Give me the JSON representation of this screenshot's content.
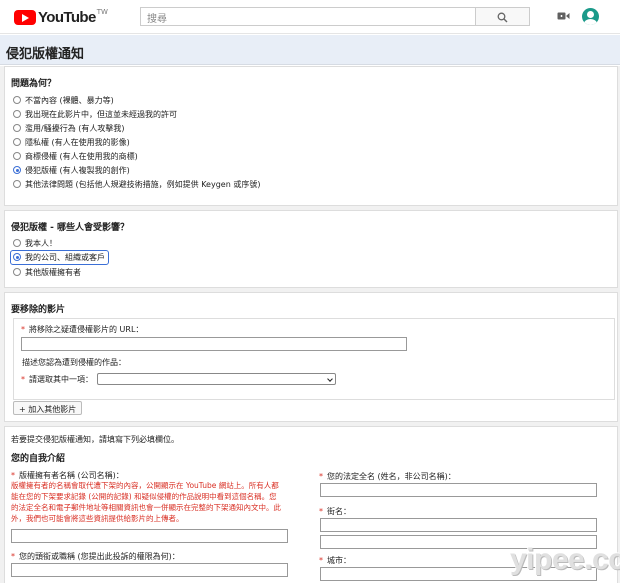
{
  "header": {
    "logo_text": "YouTube",
    "logo_region": "TW",
    "search_placeholder": "搜尋",
    "icons": [
      "search-icon",
      "video-camera-icon",
      "avatar"
    ]
  },
  "page": {
    "title": "侵犯版權通知"
  },
  "issue": {
    "title": "問題為何？",
    "options": [
      "不當內容 (裸體、暴力等)",
      "我出現在此影片中，但這並未經過我的許可",
      "濫用/騷擾行為 (有人攻擊我)",
      "隱私權 (有人在使用我的影像)",
      "商標侵權 (有人在使用我的商標)",
      "侵犯版權 (有人複製我的創作)",
      "其他法律問題 (包括他人規避技術措施，例如提供 Keygen 或序號)"
    ],
    "selected_index": 5
  },
  "affected": {
    "title": "侵犯版權 - 哪些人會受影響？",
    "options": [
      "我本人！",
      "我的公司、組織或客戶",
      "其他版權擁有者"
    ],
    "selected_index": 1
  },
  "video": {
    "title": "要移除的影片",
    "url_label": "將移除之疑遭侵權影片的 URL：",
    "url_value": "",
    "work_label": "描述您認為遭到侵權的作品：",
    "select_label": "請選取其中一項：",
    "select_value": "",
    "add_button": "+ 加入其他影片"
  },
  "intro": {
    "note": "若要提交侵犯版權通知，請填寫下列必填欄位。",
    "title": "您的自我介紹",
    "owner_label": "版權擁有者名稱 (公司名稱)：",
    "owner_warning": [
      "版權擁有者的名稱會取代遭下架的內容，公開顯示在 YouTube 網站上。所有人都",
      "能在您的下架要求記錄 (公開的記錄) 和疑似侵權的作品說明中看到這個名稱。您",
      "的法定全名和電子郵件地址等相關資訊也會一併顯示在完整的下架通知內文中。此",
      "外，我們也可能會將這些資訊提供給影片的上傳者。"
    ],
    "owner_value": "",
    "title_label": "您的頭銜或職稱 (您提出此投訴的權限為何)：",
    "title_value": "",
    "legal_name_label": "您的法定全名 (姓名，非公司名稱)：",
    "legal_name_value": "",
    "street_label": "街名：",
    "street_value_1": "",
    "street_value_2": "",
    "city_label": "城市：",
    "city_value": ""
  },
  "watermark": "yipee.cc"
}
